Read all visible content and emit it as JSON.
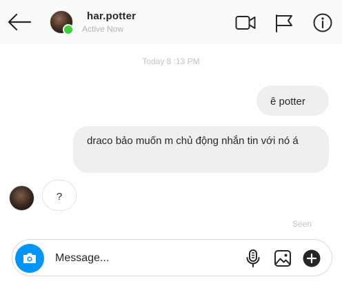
{
  "header": {
    "username": "har.potter",
    "status": "Active Now",
    "icons": [
      "back-arrow-icon",
      "video-camera-icon",
      "flag-icon",
      "info-icon"
    ]
  },
  "conversation": {
    "timestamp": "Today 8 :13 PM",
    "messages": [
      {
        "from": "me",
        "text": "ê potter"
      },
      {
        "from": "me",
        "text": "draco bảo muốn m chủ động nhắn tin với nó á"
      },
      {
        "from": "them",
        "text": "?"
      }
    ],
    "seen_label": "Seen"
  },
  "composer": {
    "placeholder": "Message...",
    "icons": [
      "camera-icon",
      "microphone-icon",
      "image-icon",
      "add-icon"
    ]
  },
  "colors": {
    "accent": "#0095f6",
    "online": "#3ad13a",
    "outgoing_bubble": "#efefef",
    "muted_text": "#c4c4c4"
  }
}
